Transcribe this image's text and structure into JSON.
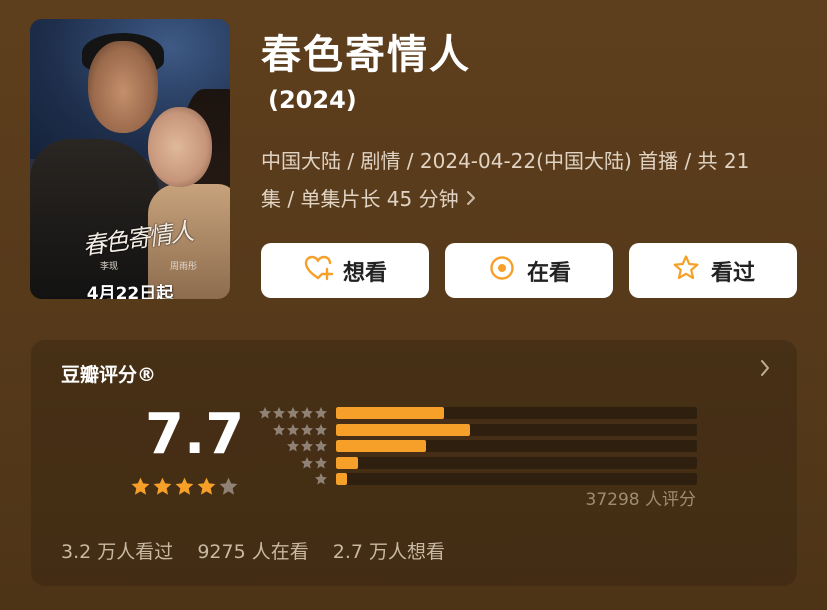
{
  "poster": {
    "calligraphy": "春色寄情人",
    "cast_left": "李现",
    "cast_right": "周雨彤",
    "release_label": "4月22日起"
  },
  "title": "春色寄情人",
  "year": "(2024)",
  "meta": {
    "line1": "中国大陆 / 剧情 / 2024-04-22(中国大陆) 首播 / 共 21",
    "line2": "集 / 单集片长 45 分钟"
  },
  "actions": {
    "want": "想看",
    "watching": "在看",
    "watched": "看过"
  },
  "rating": {
    "header": "豆瓣评分®",
    "score": "7.7",
    "avg_stars": 4,
    "distribution": [
      {
        "stars": 5,
        "fraction": 0.3
      },
      {
        "stars": 4,
        "fraction": 0.37
      },
      {
        "stars": 3,
        "fraction": 0.25
      },
      {
        "stars": 2,
        "fraction": 0.06
      },
      {
        "stars": 1,
        "fraction": 0.03
      }
    ],
    "count_label": "37298 人评分"
  },
  "stats": {
    "watched": "3.2 万人看过",
    "watching": "9275 人在看",
    "want": "2.7 万人想看"
  },
  "colors": {
    "accent": "#f6a02a",
    "background": "#5a3d1c",
    "star_off": "#8f8174"
  }
}
